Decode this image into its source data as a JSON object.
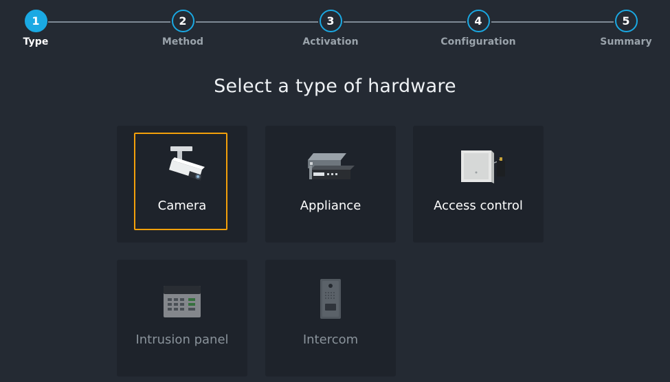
{
  "stepper": {
    "steps": [
      {
        "number": "1",
        "label": "Type",
        "state": "active"
      },
      {
        "number": "2",
        "label": "Method",
        "state": "pending"
      },
      {
        "number": "3",
        "label": "Activation",
        "state": "pending"
      },
      {
        "number": "4",
        "label": "Configuration",
        "state": "pending"
      },
      {
        "number": "5",
        "label": "Summary",
        "state": "pending"
      }
    ]
  },
  "title": "Select a type of hardware",
  "hardware_types": [
    {
      "label": "Camera",
      "icon": "camera-icon",
      "selected": true,
      "enabled": true
    },
    {
      "label": "Appliance",
      "icon": "appliance-icon",
      "selected": false,
      "enabled": true
    },
    {
      "label": "Access control",
      "icon": "access-control-icon",
      "selected": false,
      "enabled": true
    },
    {
      "label": "Intrusion panel",
      "icon": "intrusion-panel-icon",
      "selected": false,
      "enabled": false
    },
    {
      "label": "Intercom",
      "icon": "intercom-icon",
      "selected": false,
      "enabled": false
    }
  ],
  "colors": {
    "background": "#242a33",
    "tile": "#1e232b",
    "accent": "#1aa9e3",
    "selection": "#f5a10a"
  }
}
